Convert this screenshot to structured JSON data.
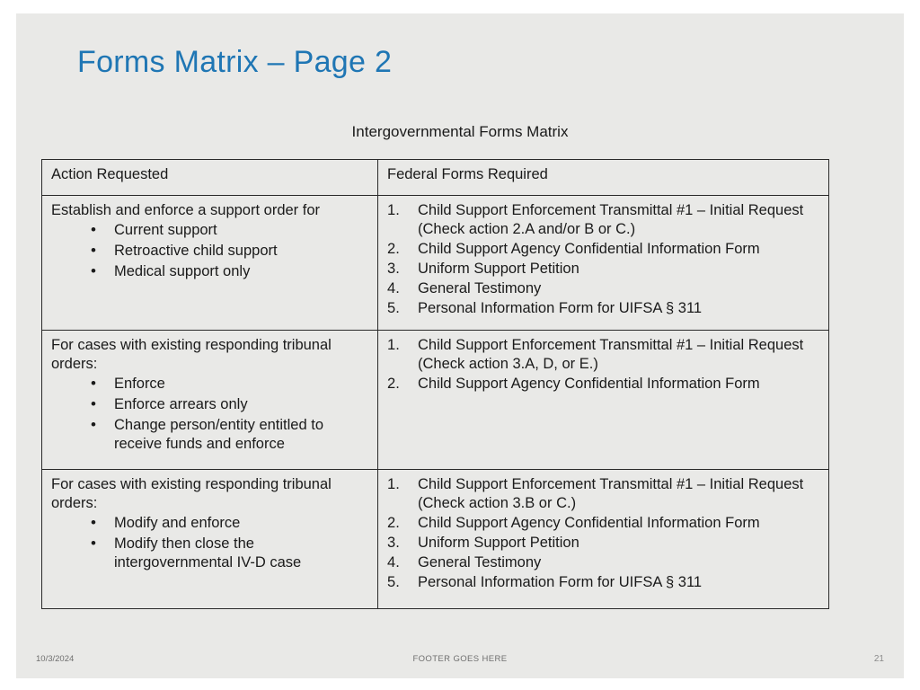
{
  "slide": {
    "title": "Forms Matrix – Page 2",
    "caption": "Intergovernmental Forms Matrix",
    "title_color": "#1f76b4",
    "background_color": "#e9e9e7"
  },
  "table": {
    "headers": {
      "col1": "Action Requested",
      "col2": "Federal Forms Required"
    },
    "rows": [
      {
        "action": {
          "lead": "Establish and enforce a support order for",
          "bullets": [
            "Current support",
            "Retroactive child support",
            "Medical support only"
          ]
        },
        "forms": [
          {
            "main": "Child Support Enforcement Transmittal #1 – Initial Request",
            "sub": "(Check action 2.A and/or B or C.)"
          },
          {
            "main": "Child Support Agency Confidential Information Form",
            "sub": ""
          },
          {
            "main": "Uniform Support Petition",
            "sub": ""
          },
          {
            "main": "General Testimony",
            "sub": ""
          },
          {
            "main": "Personal Information Form for UIFSA § 311",
            "sub": ""
          }
        ]
      },
      {
        "action": {
          "lead": "For cases with existing responding tribunal orders:",
          "bullets": [
            "Enforce",
            "Enforce arrears only",
            "Change person/entity entitled to receive funds and enforce"
          ]
        },
        "forms": [
          {
            "main": "Child Support Enforcement Transmittal #1 – Initial Request",
            "sub": "(Check action 3.A, D, or E.)"
          },
          {
            "main": "Child Support Agency Confidential Information Form",
            "sub": ""
          }
        ]
      },
      {
        "action": {
          "lead": "For cases with existing responding tribunal orders:",
          "bullets": [
            "Modify and enforce",
            "Modify then close the intergovernmental IV-D case"
          ]
        },
        "forms": [
          {
            "main": "Child Support Enforcement Transmittal #1 – Initial Request",
            "sub": "(Check action 3.B or C.)"
          },
          {
            "main": "Child Support Agency Confidential Information Form",
            "sub": ""
          },
          {
            "main": "Uniform Support Petition",
            "sub": ""
          },
          {
            "main": "General Testimony",
            "sub": ""
          },
          {
            "main": "Personal Information Form for UIFSA § 311",
            "sub": ""
          }
        ]
      }
    ]
  },
  "footer": {
    "date": "10/3/2024",
    "center_text": "FOOTER GOES HERE",
    "page_number": "21"
  }
}
